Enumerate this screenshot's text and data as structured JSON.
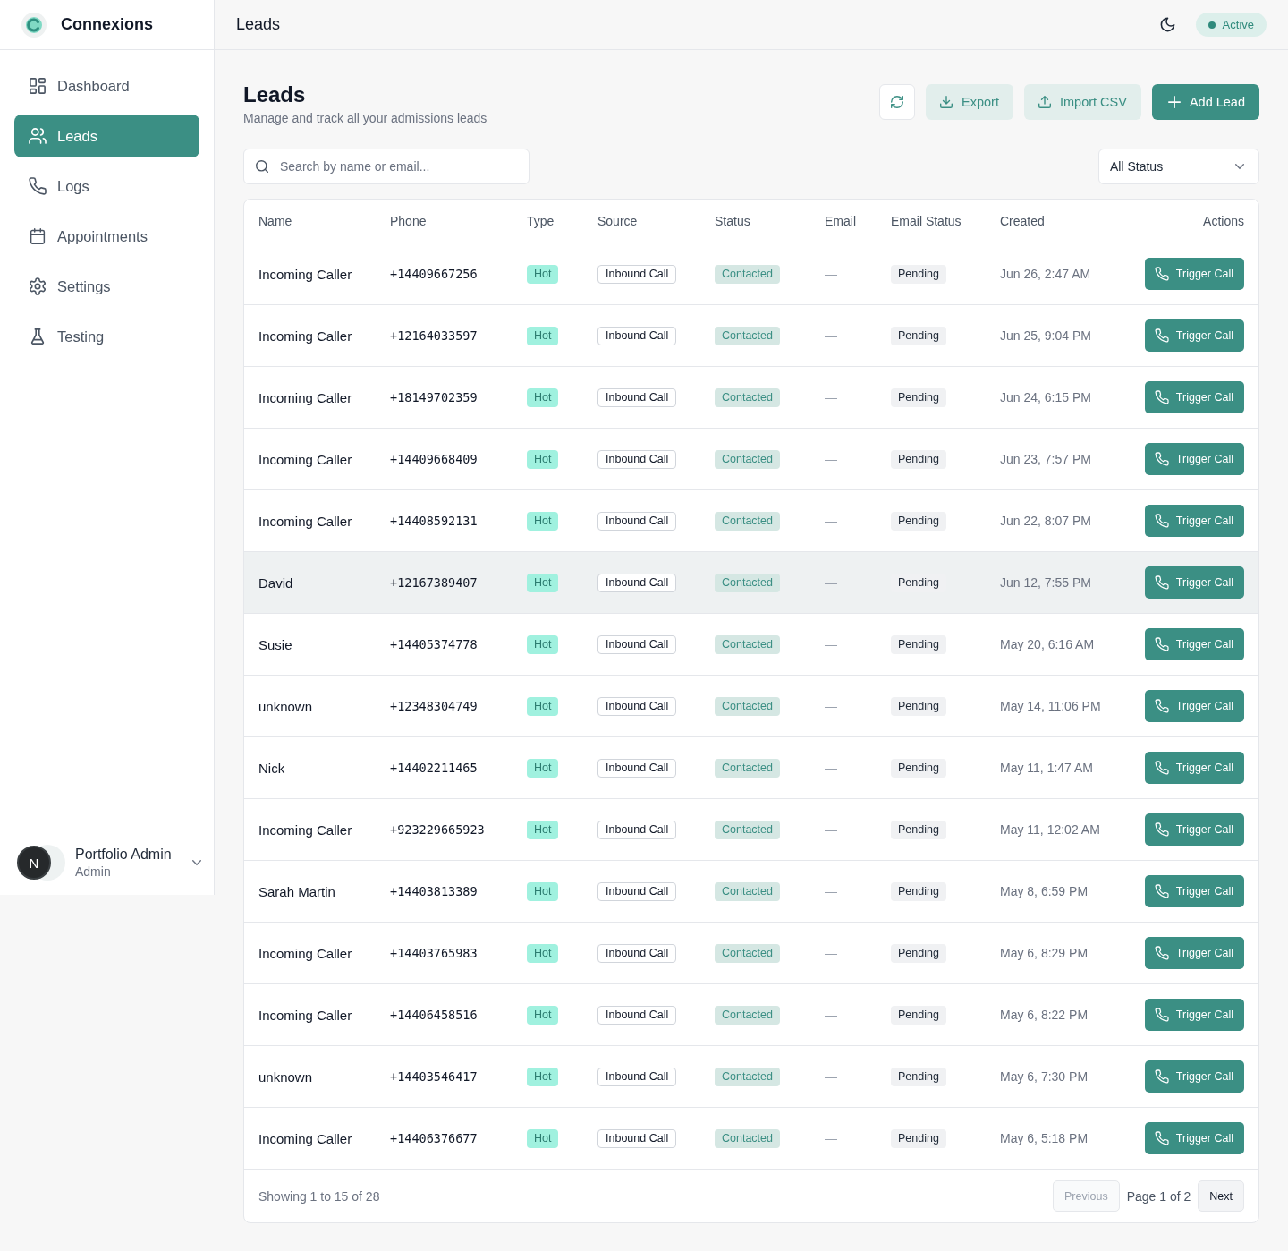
{
  "app": {
    "brand": "Connexions"
  },
  "sidebar": {
    "items": [
      {
        "label": "Dashboard",
        "selected": false
      },
      {
        "label": "Leads",
        "selected": true
      },
      {
        "label": "Logs",
        "selected": false
      },
      {
        "label": "Appointments",
        "selected": false
      },
      {
        "label": "Settings",
        "selected": false
      },
      {
        "label": "Testing",
        "selected": false
      }
    ],
    "user": {
      "initial": "N",
      "name": "Portfolio Admin",
      "role": "Admin"
    }
  },
  "topbar": {
    "title": "Leads",
    "status": "Active"
  },
  "page": {
    "title": "Leads",
    "subtitle": "Manage and track all your admissions leads",
    "actions": [
      {
        "kind": "icon"
      },
      {
        "kind": "soft",
        "label": "Export"
      },
      {
        "kind": "soft",
        "label": "Import CSV"
      },
      {
        "kind": "primary",
        "label": "Add Lead"
      }
    ],
    "search": {
      "placeholder": "Search by name or email..."
    },
    "filter": {
      "value": "All Status"
    }
  },
  "table": {
    "columns": [
      "Name",
      "Phone",
      "Type",
      "Source",
      "Status",
      "Email",
      "Email Status",
      "Created",
      "Actions"
    ],
    "rows": [
      {
        "name": "Incoming Caller",
        "phone": "+14409667256",
        "type": "Hot",
        "source": "Inbound Call",
        "status": "Contacted",
        "email": "—",
        "email_status": "Pending",
        "created": "Jun 26, 2:47 AM",
        "action": "Trigger Call",
        "highlighted": false
      },
      {
        "name": "Incoming Caller",
        "phone": "+12164033597",
        "type": "Hot",
        "source": "Inbound Call",
        "status": "Contacted",
        "email": "—",
        "email_status": "Pending",
        "created": "Jun 25, 9:04 PM",
        "action": "Trigger Call",
        "highlighted": false
      },
      {
        "name": "Incoming Caller",
        "phone": "+18149702359",
        "type": "Hot",
        "source": "Inbound Call",
        "status": "Contacted",
        "email": "—",
        "email_status": "Pending",
        "created": "Jun 24, 6:15 PM",
        "action": "Trigger Call",
        "highlighted": false
      },
      {
        "name": "Incoming Caller",
        "phone": "+14409668409",
        "type": "Hot",
        "source": "Inbound Call",
        "status": "Contacted",
        "email": "—",
        "email_status": "Pending",
        "created": "Jun 23, 7:57 PM",
        "action": "Trigger Call",
        "highlighted": false
      },
      {
        "name": "Incoming Caller",
        "phone": "+14408592131",
        "type": "Hot",
        "source": "Inbound Call",
        "status": "Contacted",
        "email": "—",
        "email_status": "Pending",
        "created": "Jun 22, 8:07 PM",
        "action": "Trigger Call",
        "highlighted": false
      },
      {
        "name": "David",
        "phone": "+12167389407",
        "type": "Hot",
        "source": "Inbound Call",
        "status": "Contacted",
        "email": "—",
        "email_status": "Pending",
        "created": "Jun 12, 7:55 PM",
        "action": "Trigger Call",
        "highlighted": true
      },
      {
        "name": "Susie",
        "phone": "+14405374778",
        "type": "Hot",
        "source": "Inbound Call",
        "status": "Contacted",
        "email": "—",
        "email_status": "Pending",
        "created": "May 20, 6:16 AM",
        "action": "Trigger Call",
        "highlighted": false
      },
      {
        "name": "unknown",
        "phone": "+12348304749",
        "type": "Hot",
        "source": "Inbound Call",
        "status": "Contacted",
        "email": "—",
        "email_status": "Pending",
        "created": "May 14, 11:06 PM",
        "action": "Trigger Call",
        "highlighted": false
      },
      {
        "name": "Nick",
        "phone": "+14402211465",
        "type": "Hot",
        "source": "Inbound Call",
        "status": "Contacted",
        "email": "—",
        "email_status": "Pending",
        "created": "May 11, 1:47 AM",
        "action": "Trigger Call",
        "highlighted": false
      },
      {
        "name": "Incoming Caller",
        "phone": "+923229665923",
        "type": "Hot",
        "source": "Inbound Call",
        "status": "Contacted",
        "email": "—",
        "email_status": "Pending",
        "created": "May 11, 12:02 AM",
        "action": "Trigger Call",
        "highlighted": false
      },
      {
        "name": "Sarah Martin",
        "phone": "+14403813389",
        "type": "Hot",
        "source": "Inbound Call",
        "status": "Contacted",
        "email": "—",
        "email_status": "Pending",
        "created": "May 8, 6:59 PM",
        "action": "Trigger Call",
        "highlighted": false
      },
      {
        "name": "Incoming Caller",
        "phone": "+14403765983",
        "type": "Hot",
        "source": "Inbound Call",
        "status": "Contacted",
        "email": "—",
        "email_status": "Pending",
        "created": "May 6, 8:29 PM",
        "action": "Trigger Call",
        "highlighted": false
      },
      {
        "name": "Incoming Caller",
        "phone": "+14406458516",
        "type": "Hot",
        "source": "Inbound Call",
        "status": "Contacted",
        "email": "—",
        "email_status": "Pending",
        "created": "May 6, 8:22 PM",
        "action": "Trigger Call",
        "highlighted": false
      },
      {
        "name": "unknown",
        "phone": "+14403546417",
        "type": "Hot",
        "source": "Inbound Call",
        "status": "Contacted",
        "email": "—",
        "email_status": "Pending",
        "created": "May 6, 7:30 PM",
        "action": "Trigger Call",
        "highlighted": false
      },
      {
        "name": "Incoming Caller",
        "phone": "+14406376677",
        "type": "Hot",
        "source": "Inbound Call",
        "status": "Contacted",
        "email": "—",
        "email_status": "Pending",
        "created": "May 6, 5:18 PM",
        "action": "Trigger Call",
        "highlighted": false
      }
    ]
  },
  "pagination": {
    "summary": "Showing 1 to 15 of 28",
    "previous": {
      "label": "Previous",
      "disabled": true
    },
    "page": "Page 1 of 2",
    "next": {
      "label": "Next",
      "disabled": false
    }
  }
}
